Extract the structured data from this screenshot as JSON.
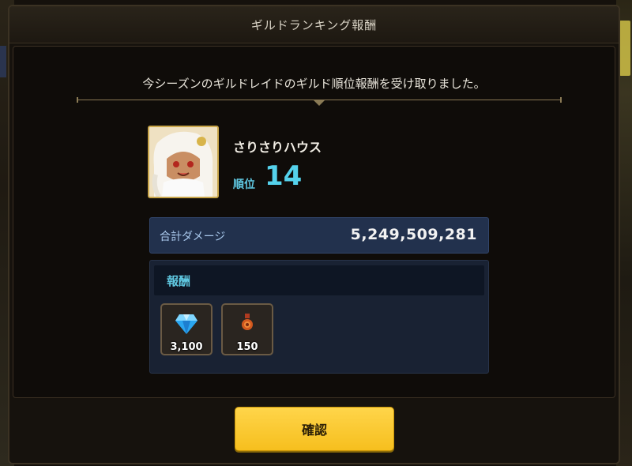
{
  "dialog": {
    "title": "ギルドランキング報酬",
    "message": "今シーズンのギルドレイドのギルド順位報酬を受け取りました。"
  },
  "guild": {
    "name": "さりさりハウス",
    "rank_label": "順位",
    "rank_value": "14"
  },
  "damage": {
    "label": "合計ダメージ",
    "value": "5,249,509,281"
  },
  "rewards": {
    "header": "報酬",
    "items": [
      {
        "icon": "diamond-gem-icon",
        "count": "3,100"
      },
      {
        "icon": "medal-pouch-icon",
        "count": "150"
      }
    ]
  },
  "confirm_button": {
    "label": "確認"
  },
  "colors": {
    "accent_cyan": "#55d2ec",
    "button_yellow": "#f6bf1e",
    "damage_bar_bg": "#22314d"
  }
}
